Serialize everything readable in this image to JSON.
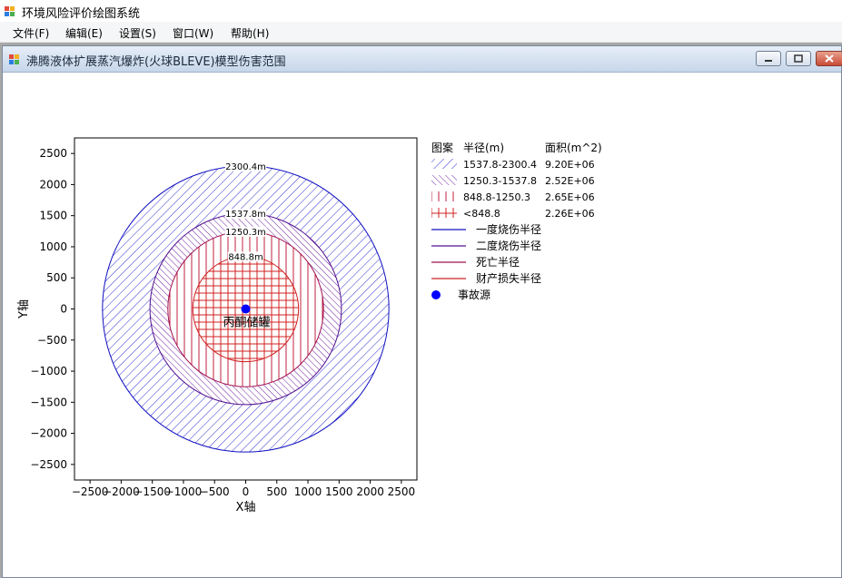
{
  "app": {
    "title": "环境风险评价绘图系统"
  },
  "menu": [
    {
      "label": "文件(F)",
      "key": "file"
    },
    {
      "label": "编辑(E)",
      "key": "edit"
    },
    {
      "label": "设置(S)",
      "key": "settings"
    },
    {
      "label": "窗口(W)",
      "key": "window"
    },
    {
      "label": "帮助(H)",
      "key": "help"
    }
  ],
  "child_window": {
    "title": "沸腾液体扩展蒸汽爆炸(火球BLEVE)模型伤害范围",
    "buttons": [
      "minimize-icon",
      "restore-icon",
      "close-icon"
    ]
  },
  "chart_data": {
    "type": "other",
    "xlabel": "X轴",
    "ylabel": "Y轴",
    "xlim": [
      -2750,
      2750
    ],
    "ylim": [
      -2750,
      2750
    ],
    "xticks": [
      -2500,
      -2000,
      -1500,
      -1000,
      -500,
      0,
      500,
      1000,
      1500,
      2000,
      2500
    ],
    "yticks": [
      2500,
      2000,
      1500,
      1000,
      500,
      0,
      -500,
      -1000,
      -1500,
      -2000,
      -2500
    ],
    "circles": [
      {
        "r": 2300.4,
        "label": "2300.4m",
        "color": "#1010c0",
        "pattern": "diag"
      },
      {
        "r": 1537.8,
        "label": "1537.8m",
        "color": "#501090",
        "pattern": "diag-dense"
      },
      {
        "r": 1250.3,
        "label": "1250.3m",
        "color": "#a01050",
        "pattern": "vert"
      },
      {
        "r": 848.8,
        "label": "848.8m",
        "color": "#d02020",
        "pattern": "grid"
      }
    ],
    "source": {
      "x": 0,
      "y": 0,
      "label": "丙酮储罐",
      "color": "#0000ff"
    },
    "legend": {
      "headers": [
        "图案",
        "半径(m)",
        "面积(m^2)"
      ],
      "areas": [
        {
          "range": "1537.8-2300.4",
          "area": "9.20E+06",
          "pattern": "diag",
          "color": "#3030d0"
        },
        {
          "range": "1250.3-1537.8",
          "area": "2.52E+06",
          "pattern": "diag-dense",
          "color": "#6020a0"
        },
        {
          "range": "848.8-1250.3",
          "area": "2.65E+06",
          "pattern": "vert",
          "color": "#c02040"
        },
        {
          "range": "<848.8",
          "area": "2.26E+06",
          "pattern": "grid",
          "color": "#d02020"
        }
      ],
      "lines": [
        {
          "label": "一度烧伤半径",
          "color": "#1010c0"
        },
        {
          "label": "二度烧伤半径",
          "color": "#501090"
        },
        {
          "label": "死亡半径",
          "color": "#a01050"
        },
        {
          "label": "财产损失半径",
          "color": "#d02020"
        }
      ],
      "source_label": "事故源"
    }
  }
}
